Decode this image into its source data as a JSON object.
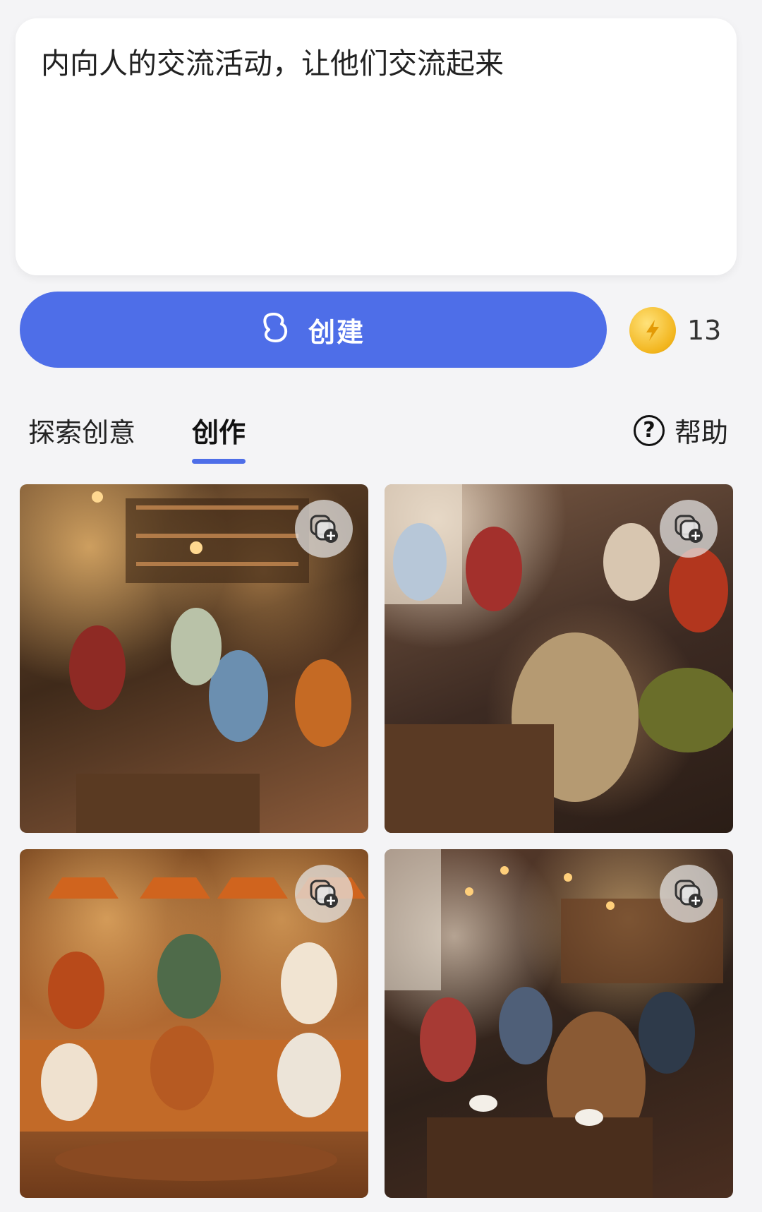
{
  "prompt": {
    "text": "内向人的交流活动，让他们交流起来"
  },
  "create_button": {
    "label": "创建",
    "icon": "brand-logo-icon"
  },
  "credits": {
    "icon": "lightning-coin-icon",
    "count": "13"
  },
  "tabs": [
    {
      "label": "探索创意",
      "active": false
    },
    {
      "label": "创作",
      "active": true
    }
  ],
  "help": {
    "label": "帮助",
    "icon": "question-circle-icon"
  },
  "images": [
    {
      "alt": "people reading in a cafe 1",
      "badge_icon": "add-to-collection-icon"
    },
    {
      "alt": "people reading in a cafe 2",
      "badge_icon": "add-to-collection-icon"
    },
    {
      "alt": "people reading in a cafe 3",
      "badge_icon": "add-to-collection-icon"
    },
    {
      "alt": "people reading in a cafe 4",
      "badge_icon": "add-to-collection-icon"
    }
  ],
  "colors": {
    "accent": "#4e6ee8",
    "coin": "#f2b51d",
    "background": "#f4f4f6"
  }
}
